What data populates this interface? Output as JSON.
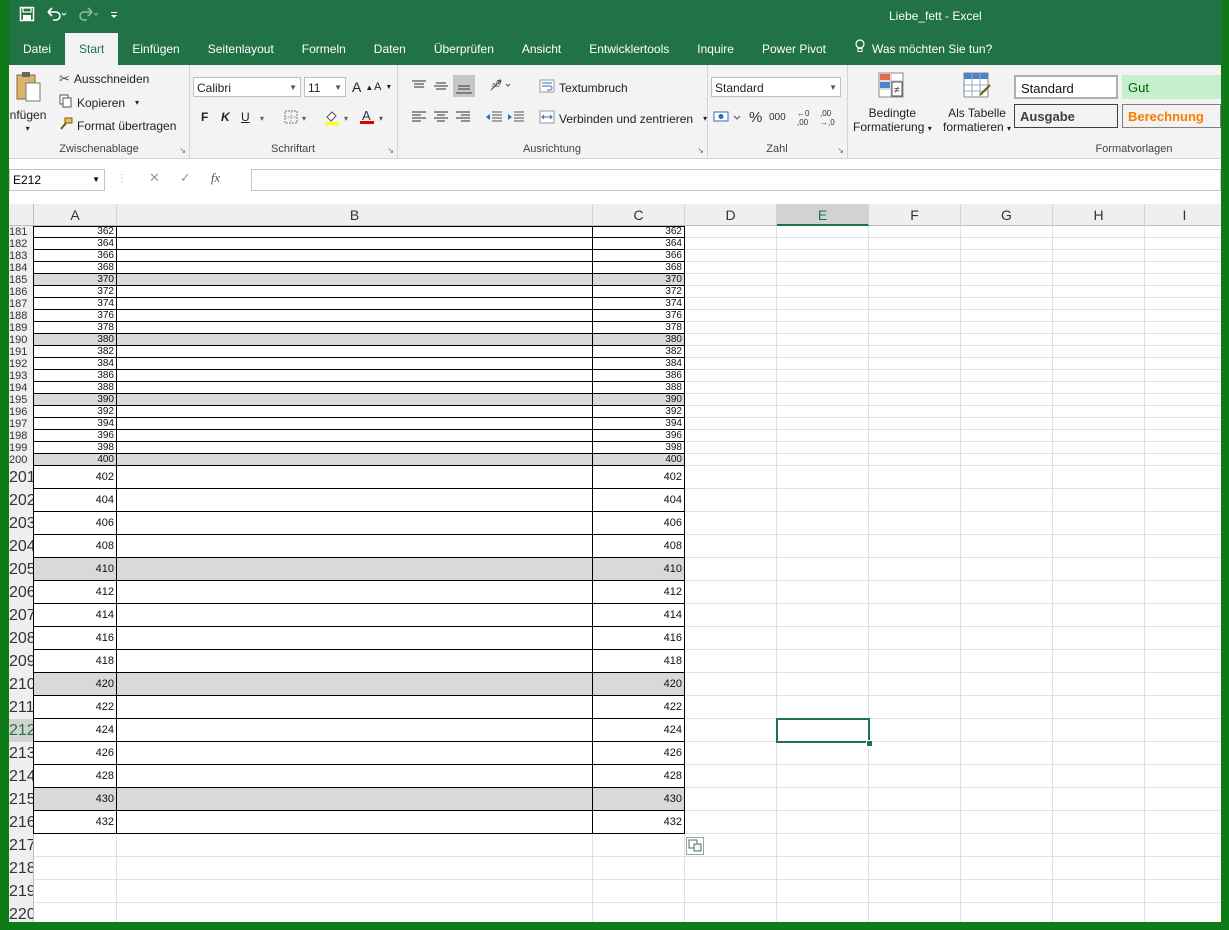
{
  "window": {
    "title": "Liebe_fett  -  Excel"
  },
  "tabs": [
    "Datei",
    "Start",
    "Einfügen",
    "Seitenlayout",
    "Formeln",
    "Daten",
    "Überprüfen",
    "Ansicht",
    "Entwicklertools",
    "Inquire",
    "Power Pivot"
  ],
  "active_tab": "Start",
  "tell_me": "Was möchten Sie tun?",
  "clipboard": {
    "paste": "Einfügen",
    "cut": "Ausschneiden",
    "copy": "Kopieren",
    "format_painter": "Format übertragen",
    "label": "Zwischenablage"
  },
  "font": {
    "name": "Calibri",
    "size": "11",
    "bold": "F",
    "italic": "K",
    "underline": "U",
    "label": "Schriftart"
  },
  "alignment": {
    "wrap": "Textumbruch",
    "merge": "Verbinden und zentrieren",
    "label": "Ausrichtung"
  },
  "number": {
    "format": "Standard",
    "label": "Zahl"
  },
  "styles": {
    "conditional_line1": "Bedingte",
    "conditional_line2": "Formatierung",
    "table_line1": "Als Tabelle",
    "table_line2": "formatieren",
    "label": "Formatvorlagen",
    "standard": "Standard",
    "gut": "Gut",
    "ausgabe": "Ausgabe",
    "berechnung": "Berechnung"
  },
  "formula_bar": {
    "name_box": "E212",
    "fx": "fx",
    "content": ""
  },
  "columns": [
    "A",
    "B",
    "C",
    "D",
    "E",
    "F",
    "G",
    "H",
    "I"
  ],
  "selected_column": "E",
  "rows_compact": [
    {
      "n": "181",
      "a": "362",
      "c": "362",
      "shaded": false
    },
    {
      "n": "182",
      "a": "364",
      "c": "364",
      "shaded": false
    },
    {
      "n": "183",
      "a": "366",
      "c": "366",
      "shaded": false
    },
    {
      "n": "184",
      "a": "368",
      "c": "368",
      "shaded": false
    },
    {
      "n": "185",
      "a": "370",
      "c": "370",
      "shaded": true
    },
    {
      "n": "186",
      "a": "372",
      "c": "372",
      "shaded": false
    },
    {
      "n": "187",
      "a": "374",
      "c": "374",
      "shaded": false
    },
    {
      "n": "188",
      "a": "376",
      "c": "376",
      "shaded": false
    },
    {
      "n": "189",
      "a": "378",
      "c": "378",
      "shaded": false
    },
    {
      "n": "190",
      "a": "380",
      "c": "380",
      "shaded": true
    },
    {
      "n": "191",
      "a": "382",
      "c": "382",
      "shaded": false
    },
    {
      "n": "192",
      "a": "384",
      "c": "384",
      "shaded": false
    },
    {
      "n": "193",
      "a": "386",
      "c": "386",
      "shaded": false
    },
    {
      "n": "194",
      "a": "388",
      "c": "388",
      "shaded": false
    },
    {
      "n": "195",
      "a": "390",
      "c": "390",
      "shaded": true
    },
    {
      "n": "196",
      "a": "392",
      "c": "392",
      "shaded": false
    },
    {
      "n": "197",
      "a": "394",
      "c": "394",
      "shaded": false
    },
    {
      "n": "198",
      "a": "396",
      "c": "396",
      "shaded": false
    },
    {
      "n": "199",
      "a": "398",
      "c": "398",
      "shaded": false
    },
    {
      "n": "200",
      "a": "400",
      "c": "400",
      "shaded": true
    }
  ],
  "rows_full": [
    {
      "n": "201",
      "a": "402",
      "c": "402",
      "shaded": false
    },
    {
      "n": "202",
      "a": "404",
      "c": "404",
      "shaded": false
    },
    {
      "n": "203",
      "a": "406",
      "c": "406",
      "shaded": false
    },
    {
      "n": "204",
      "a": "408",
      "c": "408",
      "shaded": false
    },
    {
      "n": "205",
      "a": "410",
      "c": "410",
      "shaded": true
    },
    {
      "n": "206",
      "a": "412",
      "c": "412",
      "shaded": false
    },
    {
      "n": "207",
      "a": "414",
      "c": "414",
      "shaded": false
    },
    {
      "n": "208",
      "a": "416",
      "c": "416",
      "shaded": false
    },
    {
      "n": "209",
      "a": "418",
      "c": "418",
      "shaded": false
    },
    {
      "n": "210",
      "a": "420",
      "c": "420",
      "shaded": true
    },
    {
      "n": "211",
      "a": "422",
      "c": "422",
      "shaded": false
    },
    {
      "n": "212",
      "a": "424",
      "c": "424",
      "shaded": false
    },
    {
      "n": "213",
      "a": "426",
      "c": "426",
      "shaded": false
    },
    {
      "n": "214",
      "a": "428",
      "c": "428",
      "shaded": false
    },
    {
      "n": "215",
      "a": "430",
      "c": "430",
      "shaded": true
    },
    {
      "n": "216",
      "a": "432",
      "c": "432",
      "shaded": false
    }
  ],
  "rows_empty": [
    "217",
    "218",
    "219",
    "220"
  ],
  "active_row": "212",
  "colors": {
    "excel_green": "#217346",
    "shade": "#d9d9d9",
    "frame": "#0e7a18"
  }
}
